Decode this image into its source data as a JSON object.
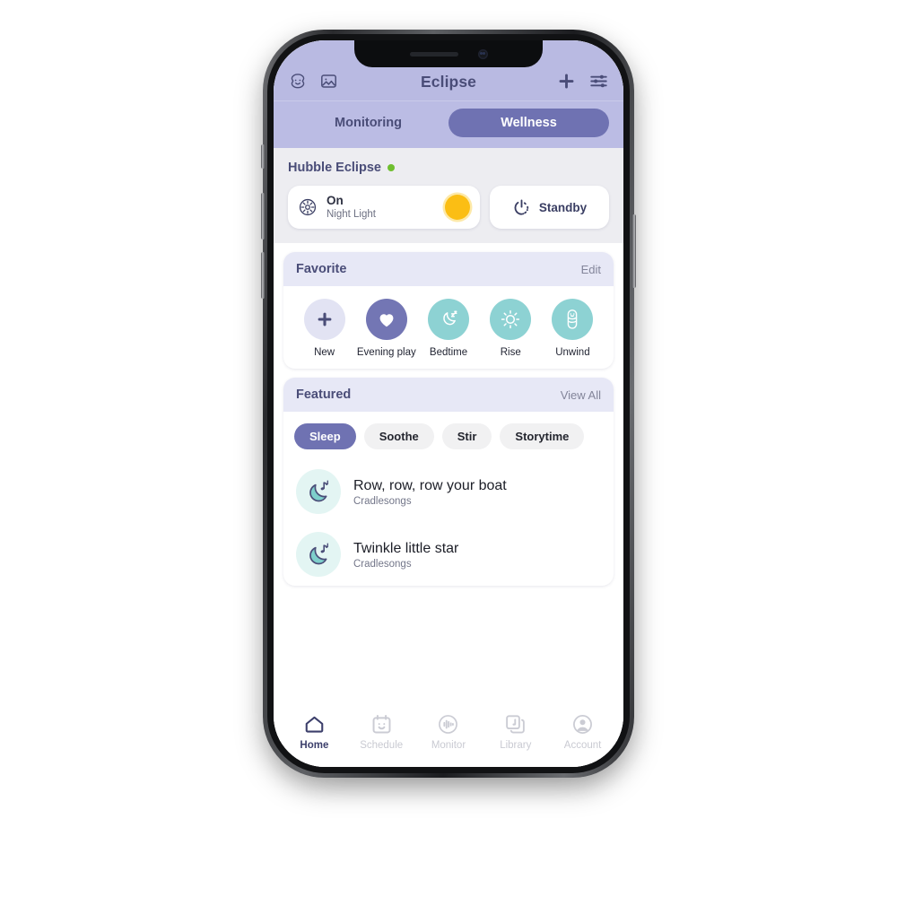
{
  "header": {
    "title": "Eclipse",
    "left_icons": [
      {
        "name": "baby-face-icon",
        "label": "Baby profile"
      },
      {
        "name": "photo-icon",
        "label": "Photos"
      }
    ],
    "right_icons": [
      {
        "name": "plus-icon",
        "label": "Add"
      },
      {
        "name": "sliders-icon",
        "label": "Settings"
      }
    ]
  },
  "segments": [
    {
      "label": "Monitoring",
      "active": false
    },
    {
      "label": "Wellness",
      "active": true
    }
  ],
  "device": {
    "name": "Hubble Eclipse",
    "status_color": "#6FBF2F",
    "light_card": {
      "icon": "night-light-icon",
      "state": "On",
      "mode": "Night Light",
      "swatch_color": "#FBBE14"
    },
    "standby_card": {
      "icon": "power-icon",
      "label": "Standby"
    }
  },
  "favorite": {
    "title": "Favorite",
    "action": "Edit",
    "items": [
      {
        "label": "New",
        "icon": "plus-icon",
        "style": "c-new"
      },
      {
        "label": "Evening play",
        "icon": "heart-icon",
        "style": "c-heart"
      },
      {
        "label": "Bedtime",
        "icon": "moon-sleep-icon",
        "style": "c-teal"
      },
      {
        "label": "Rise",
        "icon": "sun-icon",
        "style": "c-teal"
      },
      {
        "label": "Unwind",
        "icon": "swaddled-baby-icon",
        "style": "c-teal"
      }
    ]
  },
  "featured": {
    "title": "Featured",
    "action": "View All",
    "chips": [
      {
        "label": "Sleep",
        "active": true
      },
      {
        "label": "Soothe",
        "active": false
      },
      {
        "label": "Stir",
        "active": false
      },
      {
        "label": "Storytime",
        "active": false
      }
    ],
    "songs": [
      {
        "title": "Row, row, row your boat",
        "subtitle": "Cradlesongs",
        "icon": "moon-music-icon"
      },
      {
        "title": "Twinkle little star",
        "subtitle": "Cradlesongs",
        "icon": "moon-music-icon"
      }
    ]
  },
  "tabbar": [
    {
      "label": "Home",
      "icon": "home-icon",
      "active": true
    },
    {
      "label": "Schedule",
      "icon": "calendar-face-icon",
      "active": false
    },
    {
      "label": "Monitor",
      "icon": "soundwave-icon",
      "active": false
    },
    {
      "label": "Library",
      "icon": "music-library-icon",
      "active": false
    },
    {
      "label": "Account",
      "icon": "person-circle-icon",
      "active": false
    }
  ],
  "theme": {
    "appbar_bg": "#B9BAE2",
    "accent": "#6F72B2",
    "teal": "#8DD2D3",
    "text_dark": "#4A4D78"
  }
}
